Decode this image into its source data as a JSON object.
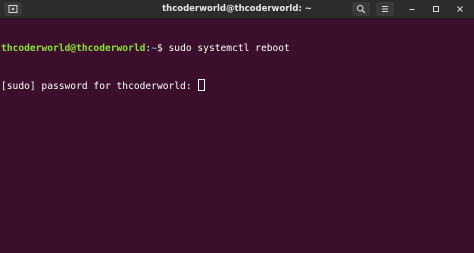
{
  "window": {
    "title": "thcoderworld@thcoderworld: ~"
  },
  "titlebar": {
    "new_tab_icon": "new-tab-icon",
    "search_icon": "search-icon",
    "menu_icon": "hamburger-menu-icon",
    "minimize_icon": "minimize-icon",
    "maximize_icon": "maximize-icon",
    "close_icon": "close-icon"
  },
  "terminal": {
    "line1": {
      "user_host": "thcoderworld@thcoderworld",
      "colon": ":",
      "path": "~",
      "symbol": "$ ",
      "command": "sudo systemctl reboot"
    },
    "line2": {
      "text": "[sudo] password for thcoderworld: "
    }
  },
  "colors": {
    "background": "#3b0f2b",
    "titlebar": "#2c2c2c",
    "prompt_user": "#8ae234",
    "prompt_path": "#729fcf",
    "text": "#ffffff"
  }
}
